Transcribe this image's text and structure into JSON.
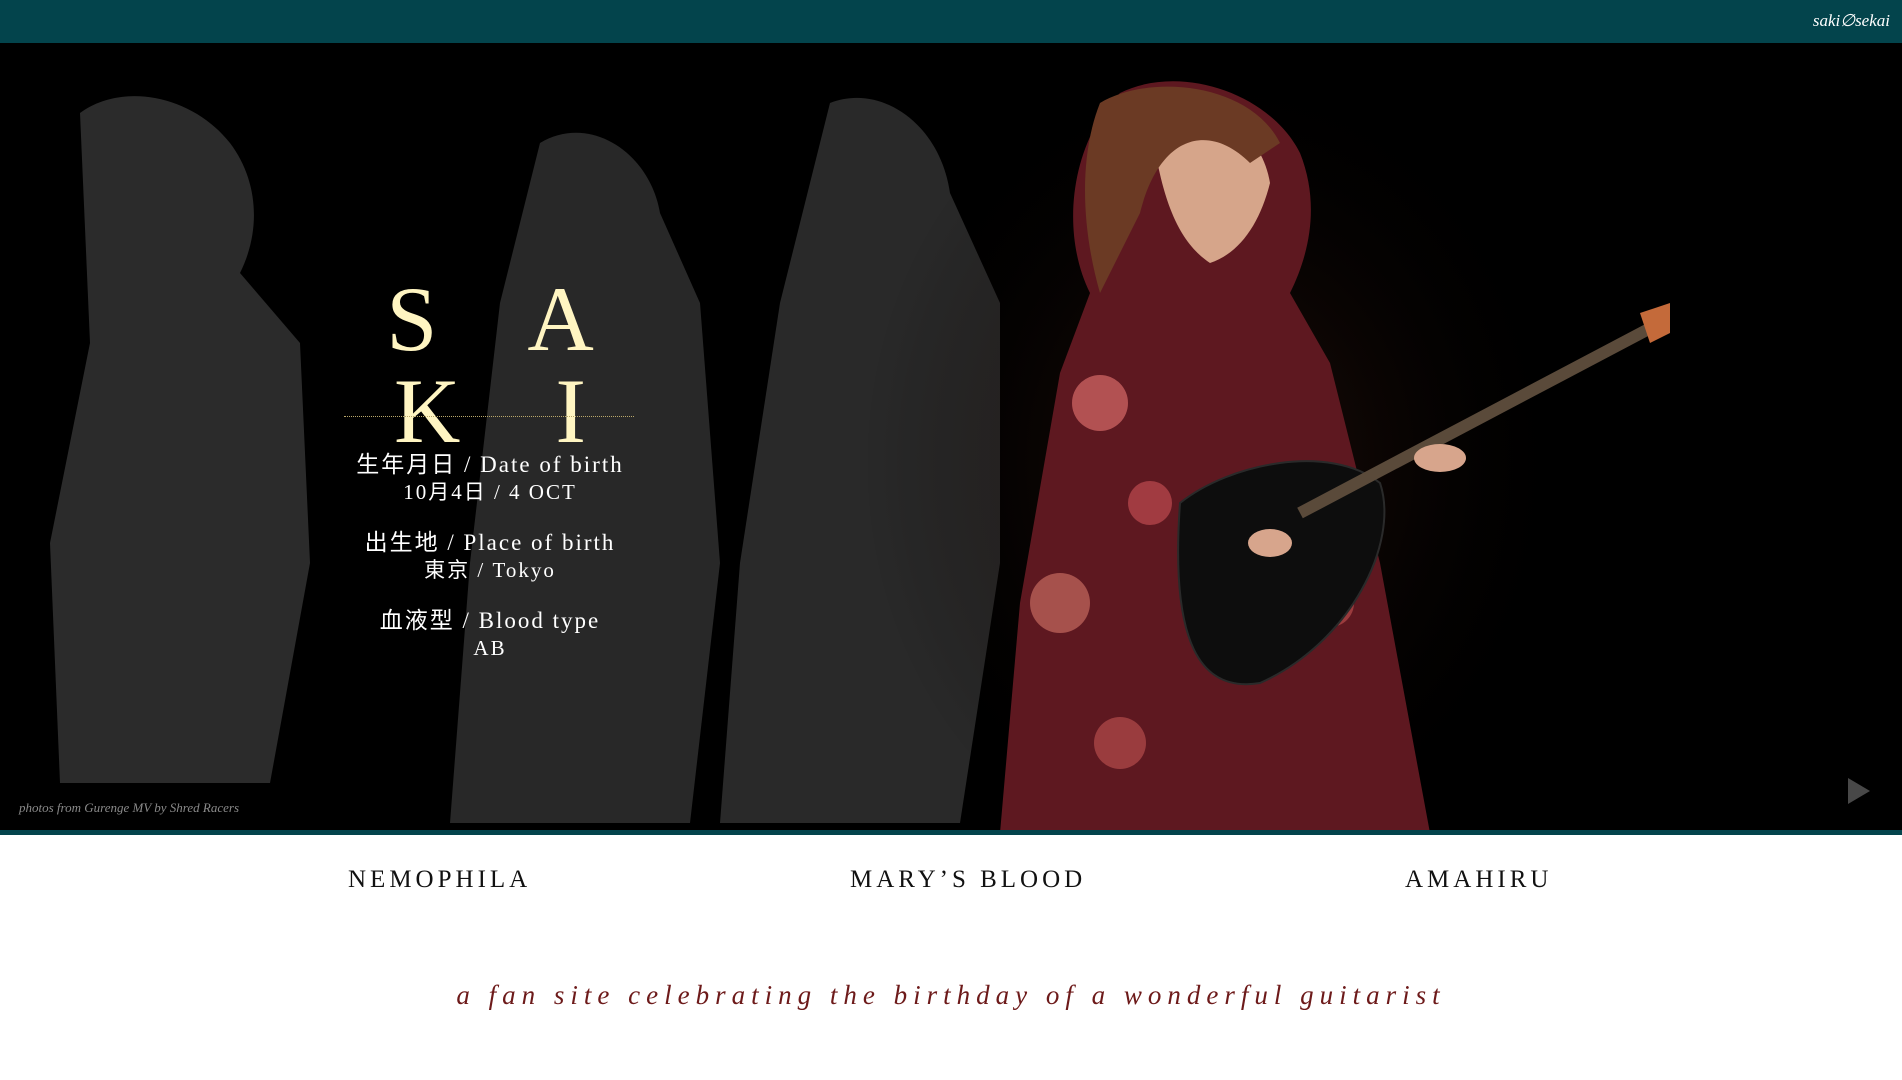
{
  "header": {
    "logo": "saki∅sekai"
  },
  "hero": {
    "title": "S A K I",
    "profile": [
      {
        "label": "生年月日 / Date of birth",
        "value": "10月4日 / 4 OCT"
      },
      {
        "label": "出生地 / Place of birth",
        "value": "東京 / Tokyo"
      },
      {
        "label": "血液型 / Blood type",
        "value": "AB"
      }
    ],
    "photo_credit": "photos from Gurenge MV by Shred Racers",
    "play_icon": "play-icon"
  },
  "nav": {
    "items": [
      "NEMOPHILA",
      "MARY’S BLOOD",
      "AMAHIRU"
    ]
  },
  "tagline": "a fan site celebrating the birthday of a wonderful guitarist",
  "colors": {
    "teal": "#03444c",
    "gold": "#fff5c2",
    "maroon": "#6d1a1a",
    "black": "#000000"
  }
}
